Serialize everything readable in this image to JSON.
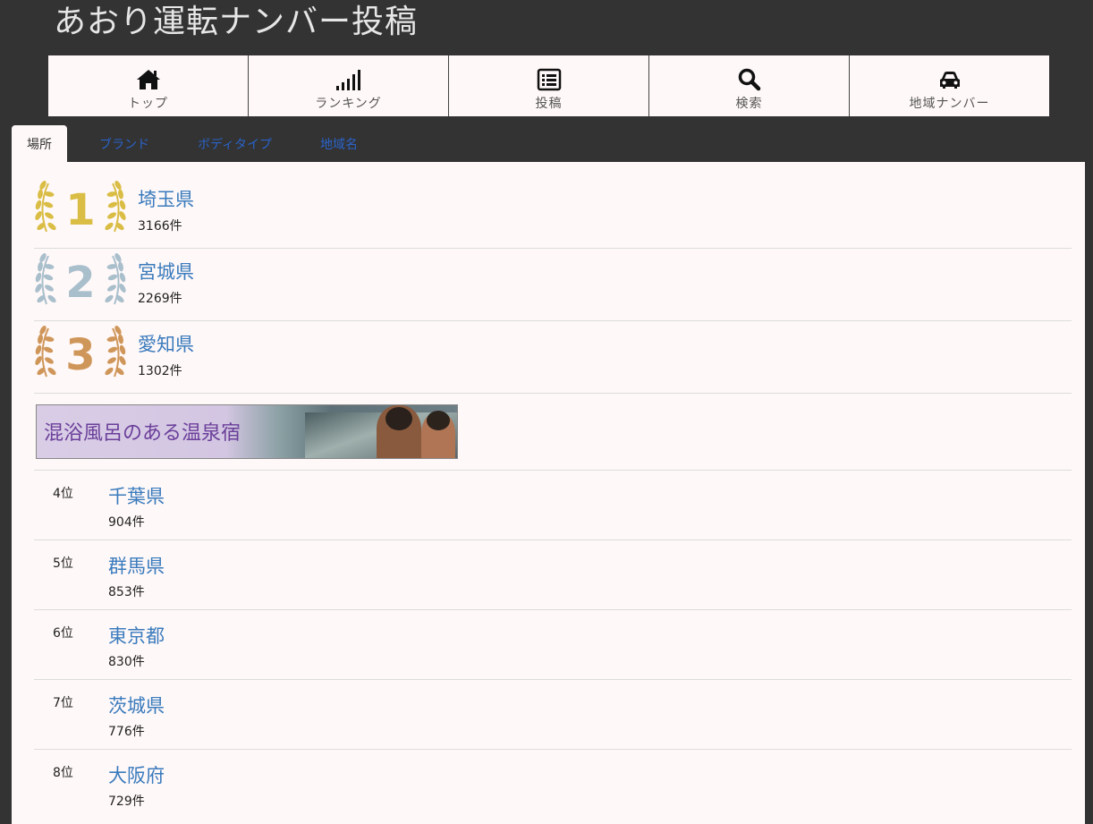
{
  "site": {
    "title": "あおり運転ナンバー投稿"
  },
  "nav": [
    {
      "label": "トップ",
      "icon": "home-icon"
    },
    {
      "label": "ランキング",
      "icon": "signal-bars-icon"
    },
    {
      "label": "投稿",
      "icon": "list-icon"
    },
    {
      "label": "検索",
      "icon": "search-icon"
    },
    {
      "label": "地域ナンバー",
      "icon": "car-icon"
    }
  ],
  "tabs": [
    {
      "label": "場所",
      "active": true
    },
    {
      "label": "ブランド",
      "active": false
    },
    {
      "label": "ボディタイプ",
      "active": false
    },
    {
      "label": "地域名",
      "active": false
    }
  ],
  "top_ranks": [
    {
      "rank": "1",
      "name": "埼玉県",
      "count": "3166件",
      "color": "#d9bd45"
    },
    {
      "rank": "2",
      "name": "宮城県",
      "count": "2269件",
      "color": "#a9bfcc"
    },
    {
      "rank": "3",
      "name": "愛知県",
      "count": "1302件",
      "color": "#cf965a"
    }
  ],
  "ad": {
    "text": "混浴風呂のある温泉宿"
  },
  "ranks": [
    {
      "pos": "4位",
      "name": "千葉県",
      "count": "904件"
    },
    {
      "pos": "5位",
      "name": "群馬県",
      "count": "853件"
    },
    {
      "pos": "6位",
      "name": "東京都",
      "count": "830件"
    },
    {
      "pos": "7位",
      "name": "茨城県",
      "count": "776件"
    },
    {
      "pos": "8位",
      "name": "大阪府",
      "count": "729件"
    }
  ],
  "colors": {
    "background": "#333333",
    "panel": "#fff8f8",
    "link": "#3a7bbd",
    "tab_link": "#2a63c9"
  }
}
